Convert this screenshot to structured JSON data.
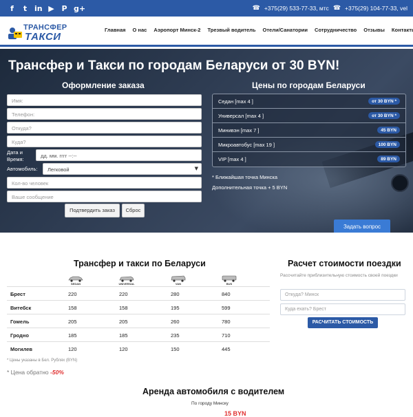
{
  "topbar": {
    "socials": [
      {
        "name": "facebook-icon",
        "glyph": "f"
      },
      {
        "name": "twitter-icon",
        "glyph": "t"
      },
      {
        "name": "linkedin-icon",
        "glyph": "in"
      },
      {
        "name": "youtube-icon",
        "glyph": "▶"
      },
      {
        "name": "pinterest-icon",
        "glyph": "P"
      },
      {
        "name": "google-plus-icon",
        "glyph": "g+"
      }
    ],
    "phone1": "+375(29) 533-77-33, мтс",
    "phone2": "+375(29) 104-77-33, vel"
  },
  "header": {
    "logo_line1": "ТРАНСФЕР",
    "logo_line2": "ТАКСИ",
    "nav": [
      "Главная",
      "О нас",
      "Аэропорт Минск-2",
      "Трезвый водитель",
      "Отели/Санатории",
      "Сотрудничество",
      "Отзывы",
      "Контакты"
    ]
  },
  "hero": {
    "title": "Трансфер и Такси по городам Беларуси от 30 BYN!",
    "order_title": "Оформление заказа",
    "prices_title": "Цены по городам Беларуси",
    "form": {
      "name_placeholder": "Имя:",
      "phone_placeholder": "Телефон:",
      "from_placeholder": "Откуда?",
      "to_placeholder": "Куда?",
      "date_label": "Дата и Время:",
      "date_placeholder": "дд. мм. гггг  --:--",
      "car_label": "Автомобиль:",
      "car_value": "Легковой",
      "people_placeholder": "Кол-во человек",
      "message_placeholder": "Ваше сообщение",
      "confirm_label": "Подтвердить заказ",
      "reset_label": "Сброс"
    },
    "prices": [
      {
        "name": "Седан",
        "cap": "[max 4 ]",
        "badge": "от 30 BYN *"
      },
      {
        "name": "Универсал",
        "cap": "[max 4 ]",
        "badge": "от 30 BYN *"
      },
      {
        "name": "Минивэн",
        "cap": "[max 7 ]",
        "badge": "45 BYN"
      },
      {
        "name": "Микроавтобус",
        "cap": "[max 19 ]",
        "badge": "100 BYN"
      },
      {
        "name": "VIP",
        "cap": "[max 4 ]",
        "badge": "89 BYN"
      }
    ],
    "note1": "* Ближайшая точка Минска",
    "note2": "Дополнительная точка + 5 BYN",
    "ask_label": "Задать вопрос"
  },
  "transfer_table": {
    "title": "Трансфер и такси по Беларуси",
    "car_types": [
      "SEDAN",
      "UNIVERSAL",
      "VAN",
      "BUS"
    ],
    "rows": [
      {
        "city": "Брест",
        "values": [
          "220",
          "220",
          "280",
          "840"
        ]
      },
      {
        "city": "Витебск",
        "values": [
          "158",
          "158",
          "195",
          "599"
        ]
      },
      {
        "city": "Гомель",
        "values": [
          "205",
          "205",
          "260",
          "780"
        ]
      },
      {
        "city": "Гродно",
        "values": [
          "185",
          "185",
          "235",
          "710"
        ]
      },
      {
        "city": "Могилев",
        "values": [
          "120",
          "120",
          "150",
          "445"
        ]
      }
    ],
    "note": "* Цены указаны в Бел. Рублях (BYN)",
    "back_price_label": "* Цена обратно",
    "back_price_value": "-50%"
  },
  "calculator": {
    "title": "Расчет стоимости поездки",
    "subtitle": "Рассчитайте приблизительную стоимость своей поездки",
    "from_placeholder": "Откуда? Минск",
    "to_placeholder": "Куда ехать? Брест",
    "button_label": "РАСЧИТАТЬ СТОИМОСТЬ"
  },
  "rent": {
    "title": "Аренда автомобиля с водителем",
    "subtitle": "По городу Минску",
    "price": "15 BYN"
  },
  "colors": {
    "brand_blue": "#2c5aa6",
    "accent_red": "#e03030",
    "ask_blue": "#3a7bd5"
  }
}
